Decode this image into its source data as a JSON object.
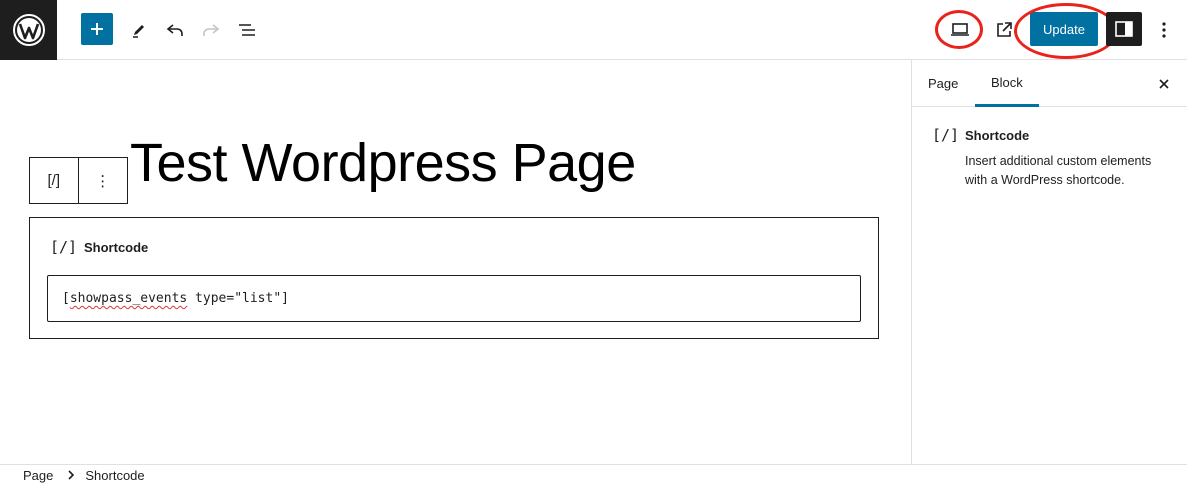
{
  "toolbar": {
    "update_label": "Update"
  },
  "icons": {
    "logo": "wordpress-logo",
    "add": "plus-icon",
    "tools": "pencil-icon",
    "undo": "undo-icon",
    "redo": "redo-icon",
    "list_view": "list-view-icon",
    "preview": "laptop-icon",
    "view_post": "external-link-icon",
    "settings": "sidebar-icon",
    "options": "more-vertical-icon",
    "close": "close-icon",
    "shortcode": "shortcode-icon"
  },
  "colors": {
    "accent": "#0071a1",
    "annotation": "#e8231b",
    "dark": "#1e1e1e"
  },
  "editor": {
    "title": "Test Wordpress Page",
    "block_toolbar": {
      "icon_text": "[/]",
      "options_text": "⋮"
    },
    "shortcode_block": {
      "icon_text": "[/]",
      "label": "Shortcode",
      "value_prefix": "[",
      "value_squiggle": "showpass_events",
      "value_suffix": " type=\"list\"]"
    }
  },
  "sidebar": {
    "tabs": [
      {
        "label": "Page"
      },
      {
        "label": "Block"
      }
    ],
    "block_info": {
      "icon_text": "[/]",
      "title": "Shortcode",
      "description": "Insert additional custom elements with a WordPress shortcode."
    }
  },
  "breadcrumb": {
    "items": [
      "Page",
      "Shortcode"
    ]
  }
}
